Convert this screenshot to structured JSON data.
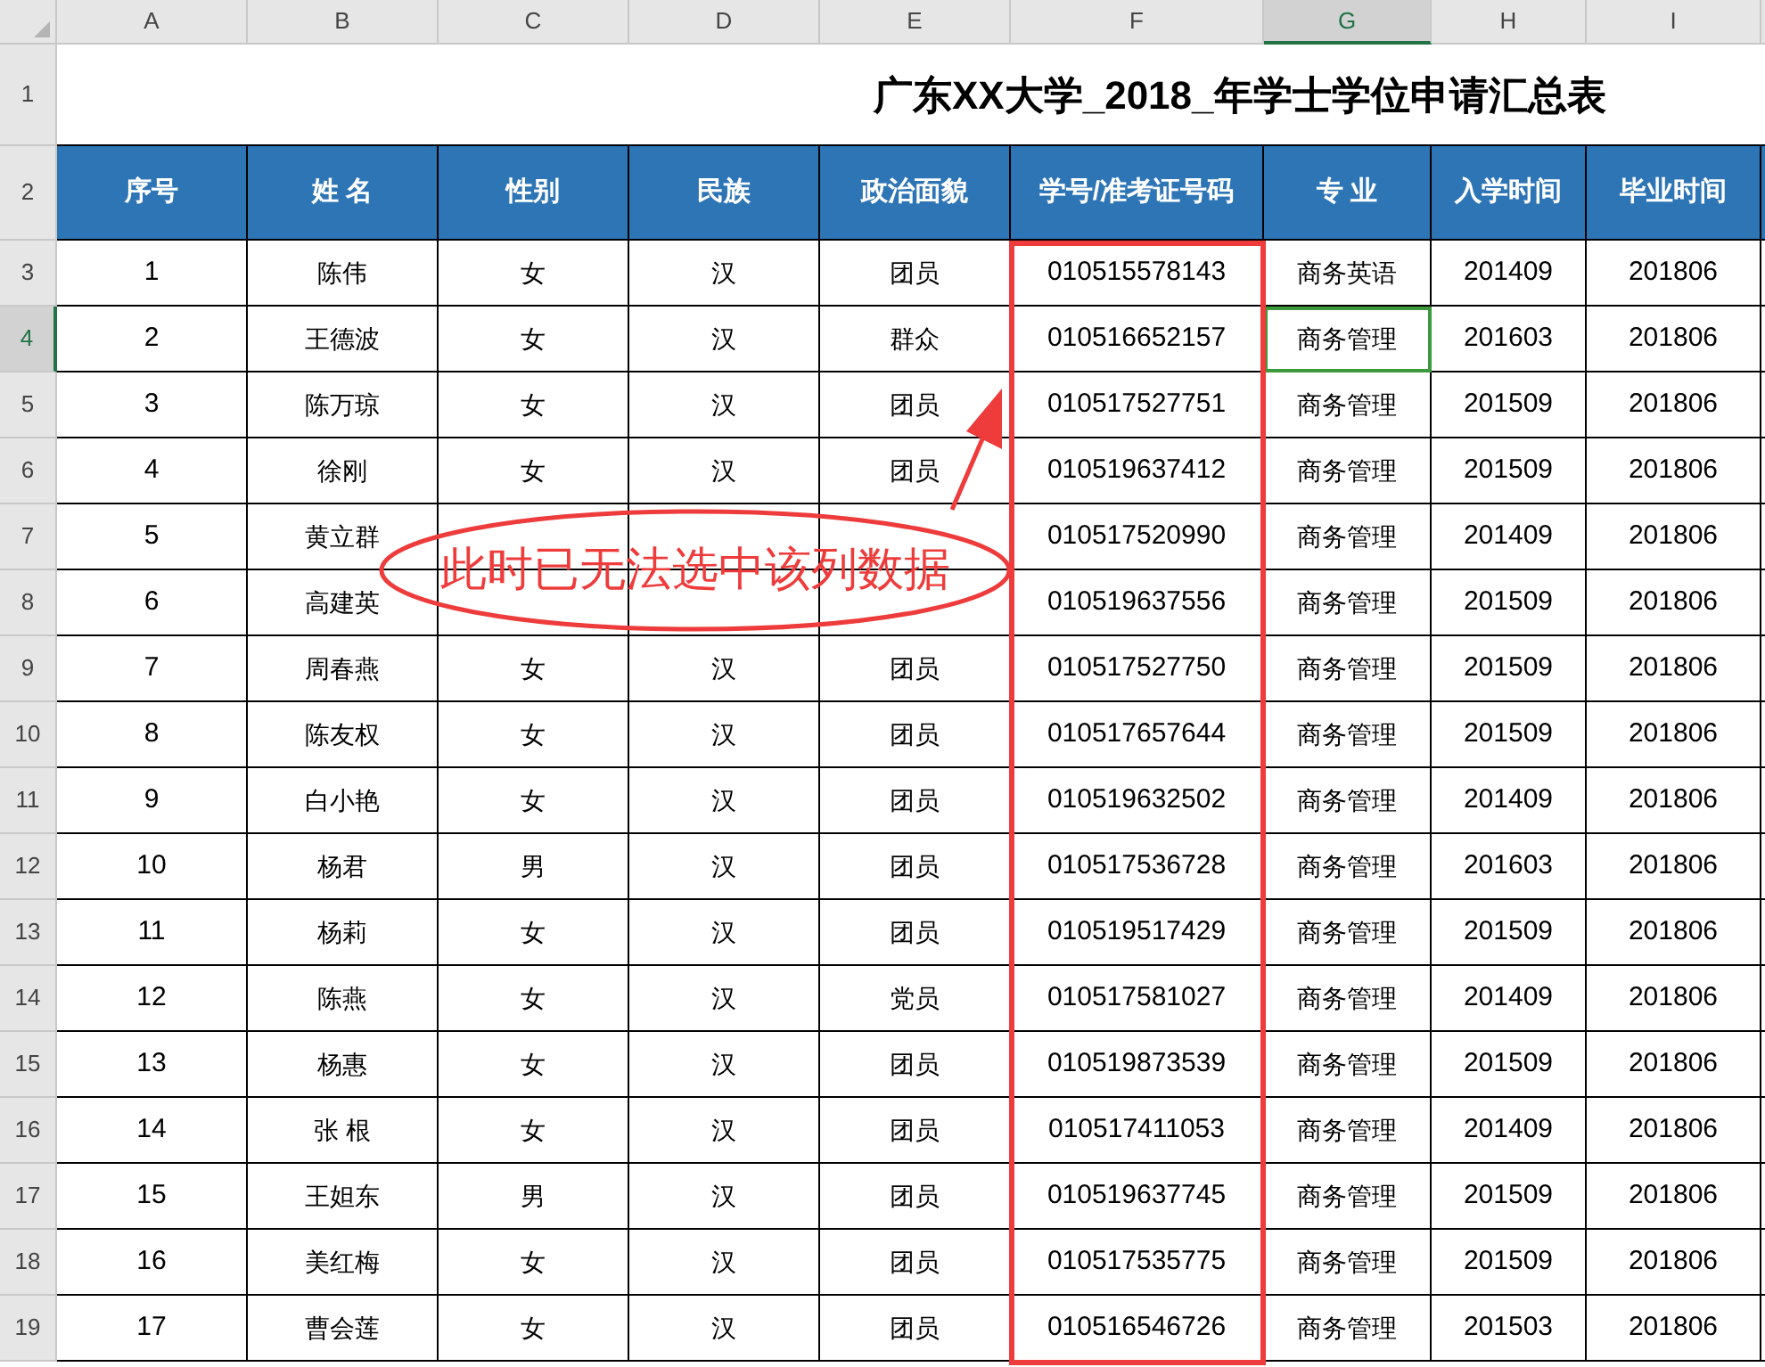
{
  "column_letters": [
    {
      "label": "A",
      "selected": false
    },
    {
      "label": "B",
      "selected": false
    },
    {
      "label": "C",
      "selected": false
    },
    {
      "label": "D",
      "selected": false
    },
    {
      "label": "E",
      "selected": false
    },
    {
      "label": "F",
      "selected": false
    },
    {
      "label": "G",
      "selected": true
    },
    {
      "label": "H",
      "selected": false
    },
    {
      "label": "I",
      "selected": false
    }
  ],
  "title_row": {
    "number": "1",
    "title": "广东XX大学_2018_年学士学位申请汇总表"
  },
  "header_row": {
    "number": "2",
    "columns": [
      "序号",
      "姓 名",
      "性别",
      "民族",
      "政治面貌",
      "学号/准考证号码",
      "专 业",
      "入学时间",
      "毕业时间"
    ]
  },
  "rows": [
    {
      "number": "3",
      "selected": false,
      "cells": [
        "1",
        "陈伟",
        "女",
        "汉",
        "团员",
        "010515578143",
        "商务英语",
        "201409",
        "201806"
      ]
    },
    {
      "number": "4",
      "selected": true,
      "cells": [
        "2",
        "王德波",
        "女",
        "汉",
        "群众",
        "010516652157",
        "商务管理",
        "201603",
        "201806"
      ]
    },
    {
      "number": "5",
      "selected": false,
      "cells": [
        "3",
        "陈万琼",
        "女",
        "汉",
        "团员",
        "010517527751",
        "商务管理",
        "201509",
        "201806"
      ]
    },
    {
      "number": "6",
      "selected": false,
      "cells": [
        "4",
        "徐刚",
        "女",
        "汉",
        "团员",
        "010519637412",
        "商务管理",
        "201509",
        "201806"
      ]
    },
    {
      "number": "7",
      "selected": false,
      "cells": [
        "5",
        "黄立群",
        null,
        null,
        null,
        "010517520990",
        "商务管理",
        "201409",
        "201806"
      ]
    },
    {
      "number": "8",
      "selected": false,
      "cells": [
        "6",
        "高建英",
        null,
        null,
        null,
        "010519637556",
        "商务管理",
        "201509",
        "201806"
      ]
    },
    {
      "number": "9",
      "selected": false,
      "cells": [
        "7",
        "周春燕",
        "女",
        "汉",
        "团员",
        "010517527750",
        "商务管理",
        "201509",
        "201806"
      ]
    },
    {
      "number": "10",
      "selected": false,
      "cells": [
        "8",
        "陈友权",
        "女",
        "汉",
        "团员",
        "010517657644",
        "商务管理",
        "201509",
        "201806"
      ]
    },
    {
      "number": "11",
      "selected": false,
      "cells": [
        "9",
        "白小艳",
        "女",
        "汉",
        "团员",
        "010519632502",
        "商务管理",
        "201409",
        "201806"
      ]
    },
    {
      "number": "12",
      "selected": false,
      "cells": [
        "10",
        "杨君",
        "男",
        "汉",
        "团员",
        "010517536728",
        "商务管理",
        "201603",
        "201806"
      ]
    },
    {
      "number": "13",
      "selected": false,
      "cells": [
        "11",
        "杨莉",
        "女",
        "汉",
        "团员",
        "010519517429",
        "商务管理",
        "201509",
        "201806"
      ]
    },
    {
      "number": "14",
      "selected": false,
      "cells": [
        "12",
        "陈燕",
        "女",
        "汉",
        "党员",
        "010517581027",
        "商务管理",
        "201409",
        "201806"
      ]
    },
    {
      "number": "15",
      "selected": false,
      "cells": [
        "13",
        "杨惠",
        "女",
        "汉",
        "团员",
        "010519873539",
        "商务管理",
        "201509",
        "201806"
      ]
    },
    {
      "number": "16",
      "selected": false,
      "cells": [
        "14",
        "张 根",
        "女",
        "汉",
        "团员",
        "010517411053",
        "商务管理",
        "201409",
        "201806"
      ]
    },
    {
      "number": "17",
      "selected": false,
      "cells": [
        "15",
        "王妲东",
        "男",
        "汉",
        "团员",
        "010519637745",
        "商务管理",
        "201509",
        "201806"
      ]
    },
    {
      "number": "18",
      "selected": false,
      "cells": [
        "16",
        "美红梅",
        "女",
        "汉",
        "团员",
        "010517535775",
        "商务管理",
        "201509",
        "201806"
      ]
    },
    {
      "number": "19",
      "selected": false,
      "cells": [
        "17",
        "曹会莲",
        "女",
        "汉",
        "团员",
        "010516546726",
        "商务管理",
        "201503",
        "201806"
      ]
    }
  ],
  "annotation": {
    "text": "此时已无法选中该列数据"
  }
}
